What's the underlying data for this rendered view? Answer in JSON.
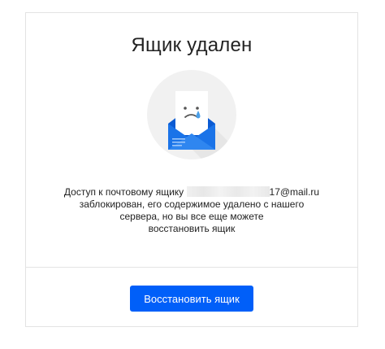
{
  "dialog": {
    "title": "Ящик удален",
    "message": {
      "line1_prefix": "Доступ к почтовому ящику",
      "line1_suffix": "17@mail.ru",
      "line2": "заблокирован, его содержимое удалено с нашего",
      "line3": "сервера, но вы все еще можете",
      "line4": "восстановить ящик"
    },
    "restore_button_label": "Восстановить ящик"
  },
  "colors": {
    "accent": "#005ff9",
    "envelope_blue": "#1a73e8",
    "illustration_bg": "#f1f1f1"
  },
  "icons": {
    "illustration": "sad-envelope-icon"
  }
}
